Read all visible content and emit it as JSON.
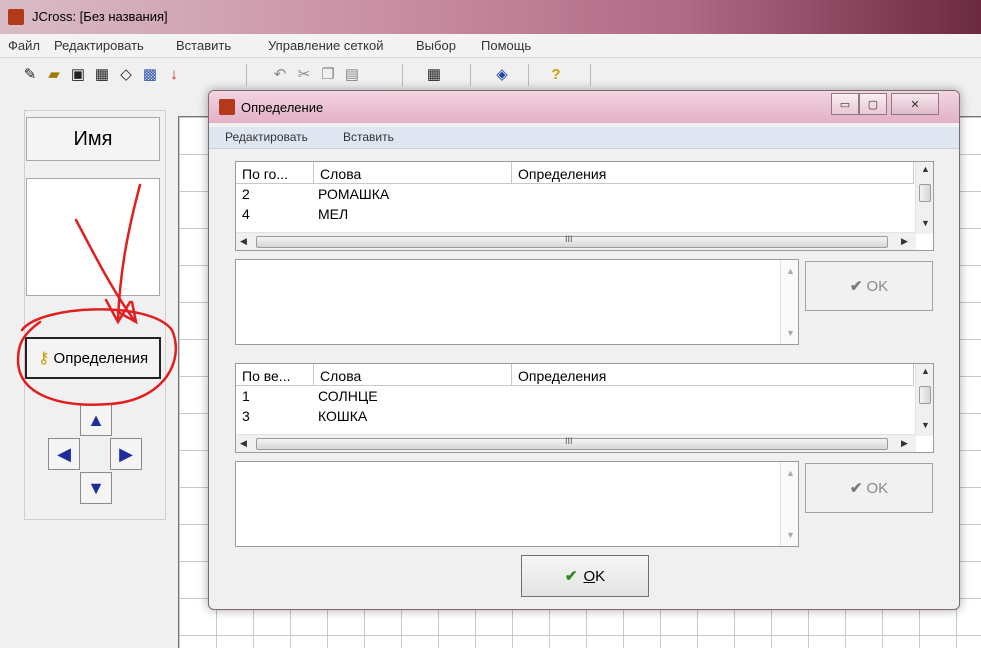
{
  "app": {
    "title": "JCross: [Без названия]",
    "menu": [
      "Файл",
      "Редактировать",
      "Вставить",
      "Управление сеткой",
      "Выбор",
      "Помощь"
    ],
    "toolbar_icons": [
      "new-icon",
      "open-icon",
      "save-icon",
      "save-as-icon",
      "eraser-icon",
      "pattern-icon",
      "down-arrow-icon",
      "undo-icon",
      "cut-icon",
      "copy-icon",
      "paste-icon",
      "grid-icon",
      "palette-icon",
      "help-icon"
    ]
  },
  "left_panel": {
    "name_label": "Имя",
    "definitions_button": "Определения",
    "arrows": {
      "up": "▲",
      "left": "◀",
      "right": "▶",
      "down": "▼"
    }
  },
  "dialog": {
    "title": "Определение",
    "menu": [
      "Редактировать",
      "Вставить"
    ],
    "window_buttons": {
      "minimize": "▭",
      "maximize": "▢",
      "close": "✕"
    },
    "horizontal": {
      "headers": [
        "По го...",
        "Слова",
        "Определения"
      ],
      "rows": [
        {
          "num": "2",
          "word": "РОМАШКА"
        },
        {
          "num": "4",
          "word": "МЕЛ"
        }
      ],
      "scroll_mark": "III",
      "ok_label": "OK"
    },
    "vertical": {
      "headers": [
        "По ве...",
        "Слова",
        "Определения"
      ],
      "rows": [
        {
          "num": "1",
          "word": "СОЛНЦЕ"
        },
        {
          "num": "3",
          "word": "КОШКА"
        }
      ],
      "scroll_mark": "III",
      "ok_label": "OK"
    },
    "main_ok": {
      "underlined": "O",
      "rest": "K"
    }
  },
  "colors": {
    "annotation": "#e02020",
    "arrow_blue": "#1d2da0",
    "check_green": "#2a8a1c"
  }
}
